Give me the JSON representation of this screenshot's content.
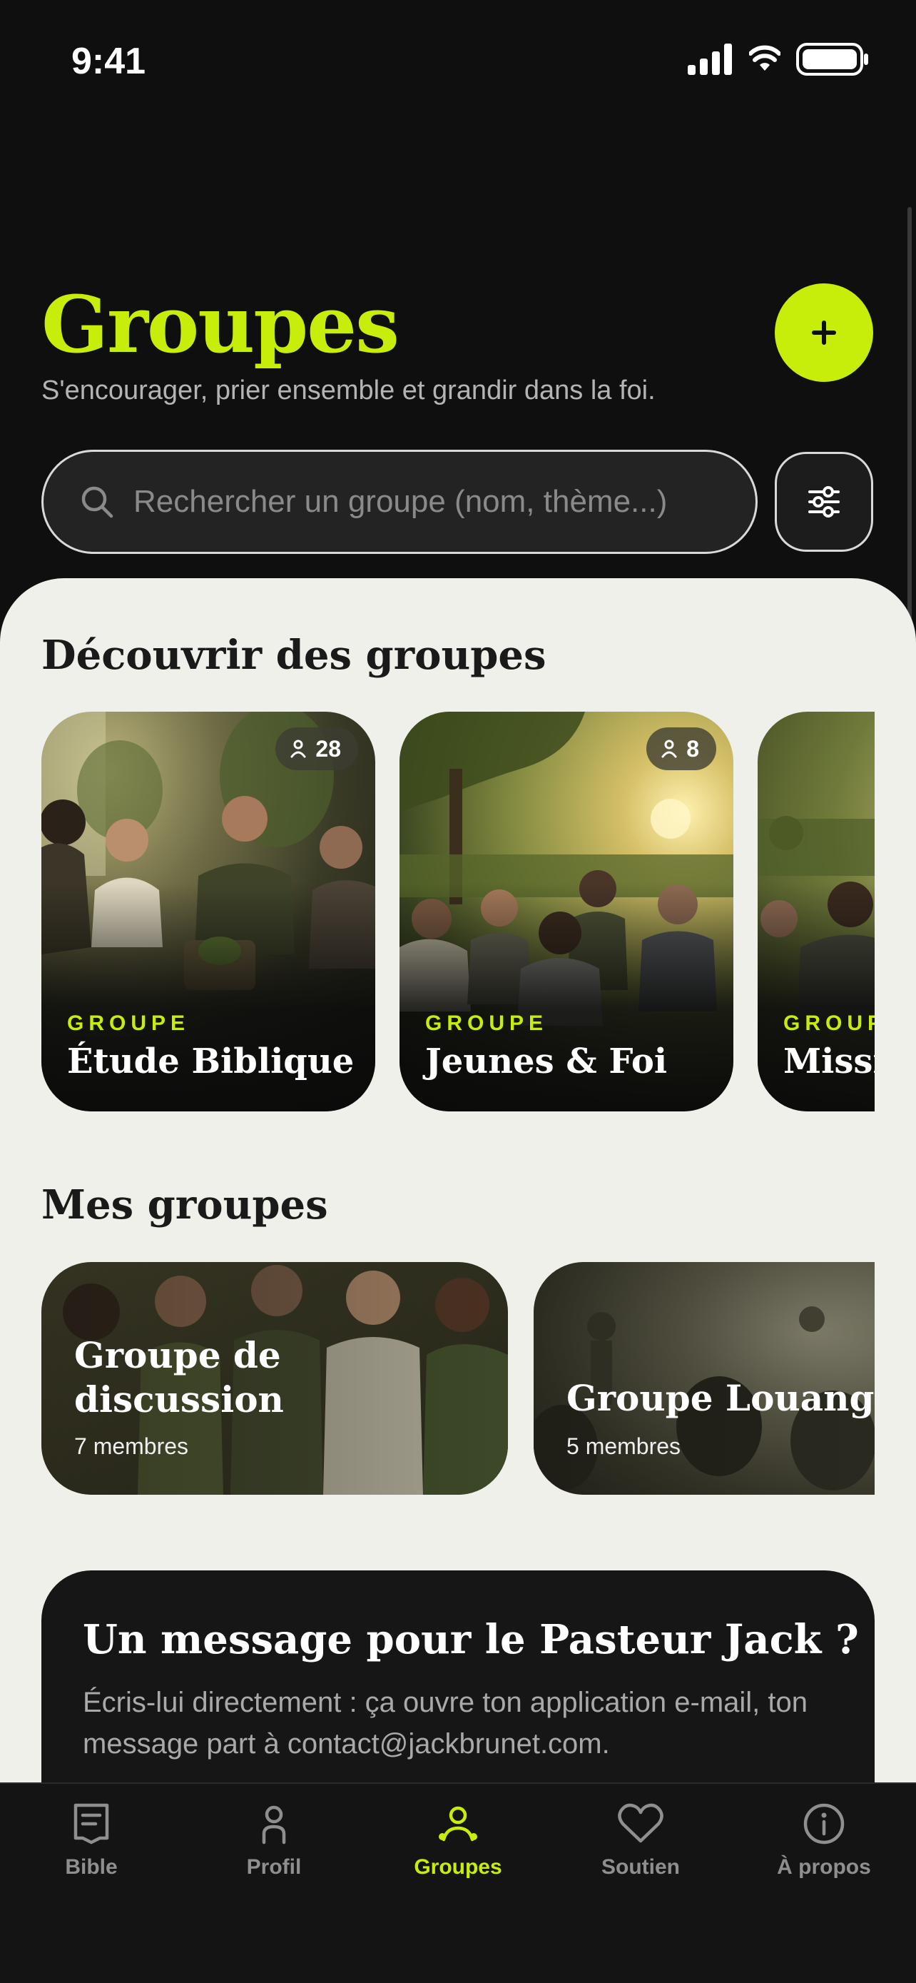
{
  "status_bar": {
    "time": "9:41"
  },
  "header": {
    "title": "Groupes",
    "subtitle": "S'encourager, prier ensemble et grandir dans la foi.",
    "add_icon": "plus-icon"
  },
  "search": {
    "placeholder": "Rechercher un groupe (nom, thème...)",
    "value": "",
    "filter_icon": "sliders-icon"
  },
  "discover": {
    "title": "Découvrir des groupes",
    "cards": [
      {
        "kicker": "GROUPE",
        "title": "Étude Biblique",
        "members": "28"
      },
      {
        "kicker": "GROUPE",
        "title": "Jeunes & Foi",
        "members": "8"
      },
      {
        "kicker": "GROUPE",
        "title": "Mission"
      }
    ]
  },
  "my_groups": {
    "title": "Mes groupes",
    "cards": [
      {
        "title_line1": "Groupe de",
        "title_line2": "discussion",
        "count": "7 membres"
      },
      {
        "title": "Groupe Louange",
        "count": "5 membres"
      }
    ]
  },
  "message": {
    "title": "Un message pour le Pasteur Jack ?",
    "body": "Écris-lui directement : ça ouvre ton application e-mail, ton message part à contact@jackbrunet.com."
  },
  "tabs": [
    {
      "label": "Bible",
      "icon": "book-icon",
      "active": false
    },
    {
      "label": "Profil",
      "icon": "person-icon",
      "active": false
    },
    {
      "label": "Groupes",
      "icon": "group-icon",
      "active": true
    },
    {
      "label": "Soutien",
      "icon": "heart-icon",
      "active": false
    },
    {
      "label": "À propos",
      "icon": "info-icon",
      "active": false
    }
  ],
  "colors": {
    "accent": "#c6ee0a",
    "background": "#0f0f0f",
    "sheet": "#f0f0eb"
  }
}
